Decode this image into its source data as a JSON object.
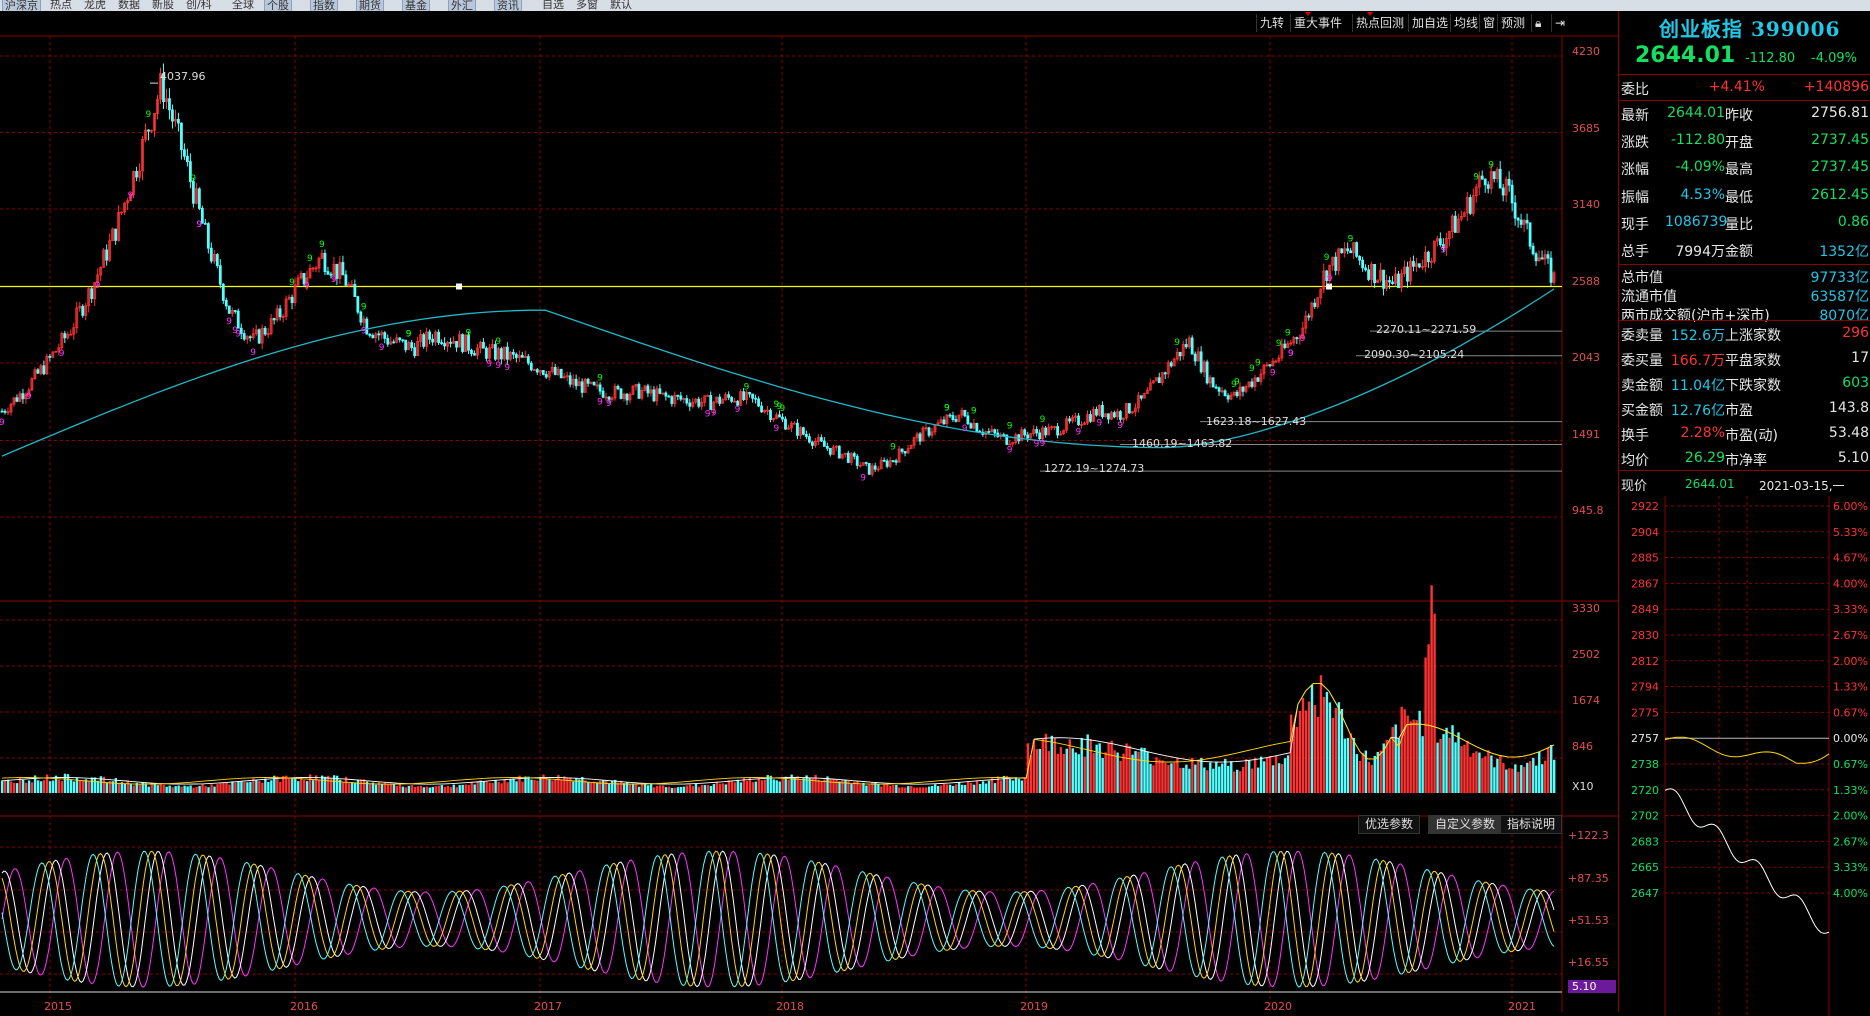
{
  "topbar": {
    "items": [
      {
        "label": "沪深京",
        "btn": true
      },
      {
        "label": "热点",
        "btn": false
      },
      {
        "label": "龙虎",
        "btn": false
      },
      {
        "label": "数据",
        "btn": false
      },
      {
        "label": "新股",
        "btn": false
      },
      {
        "label": "创/科",
        "btn": false
      },
      {
        "label": "全球",
        "btn": false
      },
      {
        "label": "个股",
        "btn": true
      },
      {
        "label": "指数",
        "btn": true
      },
      {
        "label": "期货",
        "btn": true
      },
      {
        "label": "基金",
        "btn": true
      },
      {
        "label": "外汇",
        "btn": true
      },
      {
        "label": "资讯",
        "btn": true
      },
      {
        "label": "自选",
        "btn": false
      },
      {
        "label": "多窗",
        "btn": false
      },
      {
        "label": "默认",
        "btn": false
      }
    ]
  },
  "toolbar": {
    "items": [
      "九转",
      "重大事件",
      "热点回测",
      "加自选",
      "均线",
      "窗",
      "预测"
    ]
  },
  "axes": {
    "price_ticks": [
      "4230",
      "3685",
      "3140",
      "2588",
      "2043",
      "1491",
      "945.8"
    ],
    "volume_ticks": [
      "3330",
      "2502",
      "1674",
      "846"
    ],
    "volume_unit": "X10",
    "osc_ticks": [
      "+122.3",
      "+87.35",
      "+51.53",
      "+16.55"
    ],
    "osc_current": "5.10",
    "year_labels": [
      "2015",
      "2016",
      "2017",
      "2018",
      "2019",
      "2020",
      "2021"
    ]
  },
  "annotations": {
    "peak": "4037.96",
    "levels": [
      "2270.11~2271.59",
      "2090.30~2105.24",
      "1623.18~1627.43",
      "1460.19~1463.82",
      "1272.19~1274.73"
    ]
  },
  "sub_buttons": [
    "优选参数",
    "自定义参数",
    "指标说明"
  ],
  "panel": {
    "name": "创业板指",
    "code": "399006",
    "price": "2644.01",
    "change": "-112.80",
    "change_pct": "-4.09%",
    "webi_label": "委比",
    "webi_pct": "+4.41%",
    "webi_val": "+140896",
    "rows": [
      {
        "l1": "最新",
        "v1": "2644.01",
        "c1": "green",
        "l2": "昨收",
        "v2": "2756.81",
        "c2": "white"
      },
      {
        "l1": "涨跌",
        "v1": "-112.80",
        "c1": "green",
        "l2": "开盘",
        "v2": "2737.45",
        "c2": "green"
      },
      {
        "l1": "涨幅",
        "v1": "-4.09%",
        "c1": "green",
        "l2": "最高",
        "v2": "2737.45",
        "c2": "green"
      },
      {
        "l1": "振幅",
        "v1": "4.53%",
        "c1": "cyan",
        "l2": "最低",
        "v2": "2612.45",
        "c2": "green"
      },
      {
        "l1": "现手",
        "v1": "1086739",
        "c1": "cyan",
        "l2": "量比",
        "v2": "0.86",
        "c2": "green"
      },
      {
        "l1": "总手",
        "v1": "7994万",
        "c1": "white",
        "l2": "金额",
        "v2": "1352亿",
        "c2": "cyan"
      }
    ],
    "mkt": [
      {
        "l": "总市值",
        "v": "97733亿"
      },
      {
        "l": "流通市值",
        "v": "63587亿"
      },
      {
        "l": "两市成交额(沪市+深市)",
        "v": "8070亿"
      }
    ],
    "rows2": [
      {
        "l1": "委卖量",
        "v1": "152.6万",
        "c1": "cyan",
        "l2": "上涨家数",
        "v2": "296",
        "c2": "red"
      },
      {
        "l1": "委买量",
        "v1": "166.7万",
        "c1": "red",
        "l2": "平盘家数",
        "v2": "17",
        "c2": "white"
      },
      {
        "l1": "卖金额",
        "v1": "11.04亿",
        "c1": "cyan",
        "l2": "下跌家数",
        "v2": "603",
        "c2": "green"
      },
      {
        "l1": "买金额",
        "v1": "12.76亿",
        "c1": "cyan",
        "l2": "市盈",
        "v2": "143.8",
        "c2": "white"
      },
      {
        "l1": "换手",
        "v1": "2.28%",
        "c1": "red",
        "l2": "市盈(动)",
        "v2": "53.48",
        "c2": "white"
      },
      {
        "l1": "均价",
        "v1": "26.29",
        "c1": "green",
        "l2": "市净率",
        "v2": "5.10",
        "c2": "white"
      }
    ],
    "cursor_label": "现价",
    "cursor_price": "2644.01",
    "cursor_date": "2021-03-15,一",
    "intraday_price_ticks": [
      "2922",
      "2904",
      "2885",
      "2867",
      "2849",
      "2830",
      "2812",
      "2794",
      "2775",
      "2757",
      "2738",
      "2720",
      "2702",
      "2683",
      "2665",
      "2647"
    ],
    "intraday_pct_ticks": [
      "6.00%",
      "5.33%",
      "4.67%",
      "4.00%",
      "3.33%",
      "2.67%",
      "2.00%",
      "1.33%",
      "0.67%",
      "0.00%",
      "0.67%",
      "1.33%",
      "2.00%",
      "2.67%",
      "3.33%",
      "4.00%"
    ]
  },
  "colors": {
    "up": "#ff3232",
    "down": "#54ffff",
    "ma": "#20b8c8",
    "hline": "#ffff00",
    "grid": "#8b0000",
    "axis": "#e05050",
    "nine_up": "#00ff00",
    "nine_down": "#ff33ff"
  },
  "chart_data": {
    "type": "line",
    "title": "",
    "price_series_weekly_close": [
      1700,
      1850,
      2050,
      2280,
      2600,
      3000,
      3500,
      4037,
      3500,
      2900,
      2400,
      2200,
      2350,
      2600,
      2800,
      2650,
      2300,
      2200,
      2150,
      2250,
      2200,
      2130,
      2100,
      2050,
      1980,
      1900,
      1850,
      1830,
      1840,
      1800,
      1780,
      1760,
      1800,
      1770,
      1650,
      1550,
      1450,
      1380,
      1280,
      1350,
      1500,
      1600,
      1680,
      1560,
      1500,
      1540,
      1560,
      1620,
      1700,
      1680,
      1780,
      2000,
      2200,
      1900,
      1800,
      1950,
      2100,
      2300,
      2700,
      2850,
      2700,
      2600,
      2750,
      2900,
      3100,
      3400,
      3250,
      2900,
      2644
    ],
    "ma_line": {
      "start": 1380,
      "mid_peak": 2420,
      "low": 1440,
      "end": 2570
    },
    "volume_range": [
      0,
      3330
    ],
    "osc_range": [
      5.1,
      122.3
    ]
  }
}
